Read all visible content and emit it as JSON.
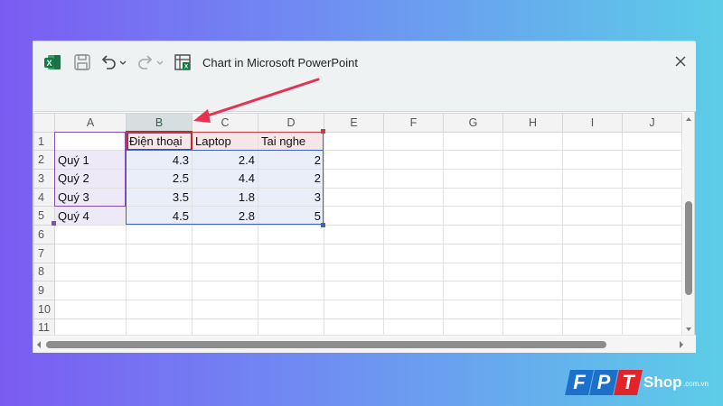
{
  "window": {
    "title": "Chart in Microsoft PowerPoint",
    "icons": [
      "excel-icon",
      "save-icon",
      "undo-icon",
      "redo-icon",
      "embedded-sheet-icon",
      "close-icon"
    ]
  },
  "sheet": {
    "columns": [
      "A",
      "B",
      "C",
      "D",
      "E",
      "F",
      "G",
      "H",
      "I",
      "J"
    ],
    "rows": [
      "1",
      "2",
      "3",
      "4",
      "5",
      "6",
      "7",
      "8",
      "9",
      "10",
      "11"
    ],
    "selected_column": "B",
    "header_row": [
      "",
      "Điện thoại",
      "Laptop",
      "Tai nghe"
    ],
    "data_rows": [
      [
        "Quý 1",
        "4.3",
        "2.4",
        "2"
      ],
      [
        "Quý 2",
        "2.5",
        "4.4",
        "2"
      ],
      [
        "Quý 3",
        "3.5",
        "1.8",
        "3"
      ],
      [
        "Quý 4",
        "4.5",
        "2.8",
        "5"
      ]
    ]
  },
  "range_colors": {
    "labels": "#7f4fb5",
    "headers": "#cc3b45",
    "values": "#3b62c6",
    "annotation_arrow": "#e8314f"
  },
  "branding": {
    "letters": [
      "F",
      "P",
      "T"
    ],
    "shop": "Shop",
    "domain": ".com.vn"
  }
}
